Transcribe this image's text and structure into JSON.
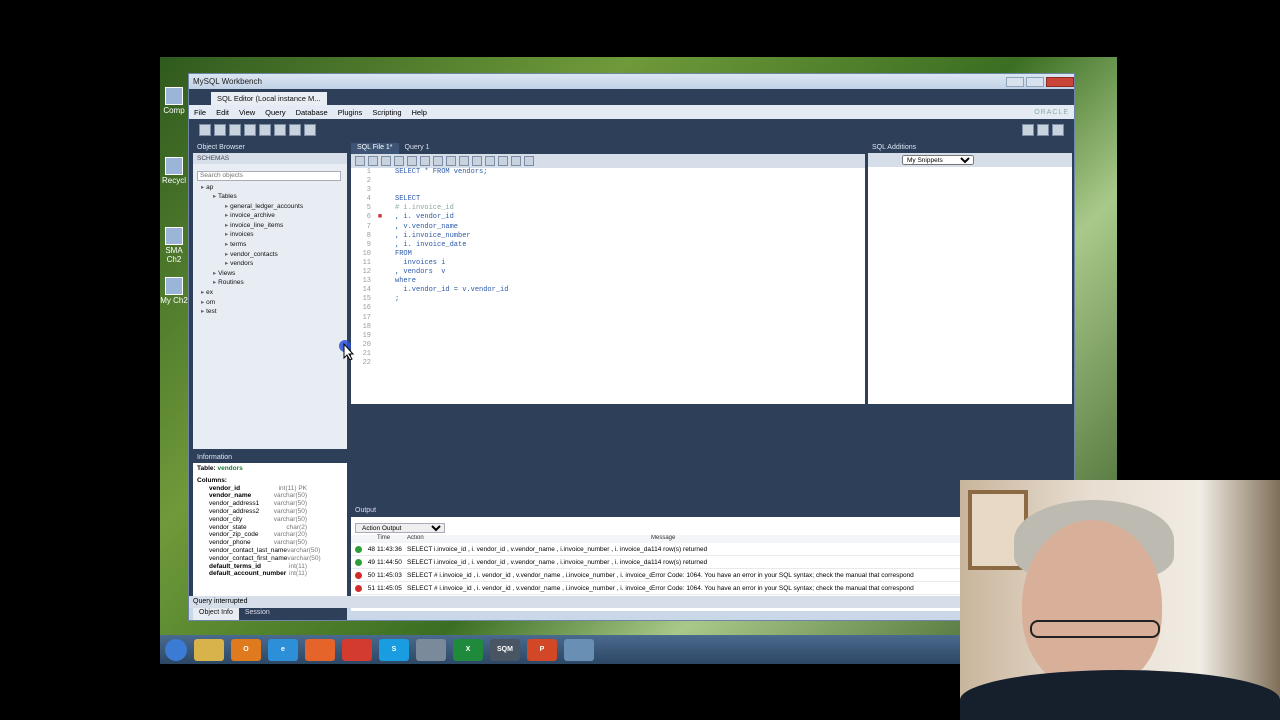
{
  "window": {
    "title": "MySQL Workbench",
    "tab": "SQL Editor (Local instance M...",
    "menu": [
      "File",
      "Edit",
      "View",
      "Query",
      "Database",
      "Plugins",
      "Scripting",
      "Help"
    ],
    "brand": "ORACLE"
  },
  "desktop_icons": [
    "Comp",
    "Recycl",
    "SMA Ch2",
    "My Ch2"
  ],
  "object_browser": {
    "title": "Object Browser",
    "schemas_label": "SCHEMAS",
    "search_placeholder": "Search objects",
    "tree": [
      {
        "label": "ap",
        "level": 0
      },
      {
        "label": "Tables",
        "level": 1
      },
      {
        "label": "general_ledger_accounts",
        "level": 2
      },
      {
        "label": "invoice_archive",
        "level": 2
      },
      {
        "label": "invoice_line_items",
        "level": 2
      },
      {
        "label": "invoices",
        "level": 2
      },
      {
        "label": "terms",
        "level": 2
      },
      {
        "label": "vendor_contacts",
        "level": 2
      },
      {
        "label": "vendors",
        "level": 2
      },
      {
        "label": "Views",
        "level": 1
      },
      {
        "label": "Routines",
        "level": 1
      },
      {
        "label": "ex",
        "level": 0
      },
      {
        "label": "om",
        "level": 0
      },
      {
        "label": "test",
        "level": 0
      }
    ]
  },
  "information": {
    "title": "Information",
    "table_label": "Table:",
    "table_name": "vendors",
    "columns_label": "Columns:",
    "columns": [
      {
        "name": "vendor_id",
        "type": "int(11) PK",
        "bold": true
      },
      {
        "name": "vendor_name",
        "type": "varchar(50)",
        "bold": true
      },
      {
        "name": "vendor_address1",
        "type": "varchar(50)",
        "bold": false
      },
      {
        "name": "vendor_address2",
        "type": "varchar(50)",
        "bold": false
      },
      {
        "name": "vendor_city",
        "type": "varchar(50)",
        "bold": false
      },
      {
        "name": "vendor_state",
        "type": "char(2)",
        "bold": false
      },
      {
        "name": "vendor_zip_code",
        "type": "varchar(20)",
        "bold": false
      },
      {
        "name": "vendor_phone",
        "type": "varchar(50)",
        "bold": false
      },
      {
        "name": "vendor_contact_last_name",
        "type": "varchar(50)",
        "bold": false
      },
      {
        "name": "vendor_contact_first_name",
        "type": "varchar(50)",
        "bold": false
      },
      {
        "name": "default_terms_id",
        "type": "int(11)",
        "bold": true
      },
      {
        "name": "default_account_number",
        "type": "int(11)",
        "bold": true
      }
    ],
    "tabs": [
      "Object Info",
      "Session"
    ]
  },
  "editor": {
    "tabs": [
      "SQL File 1*",
      "Query 1"
    ],
    "lines": [
      {
        "n": "1",
        "text": "SELECT * FROM vendors;",
        "mark": "",
        "comment": false
      },
      {
        "n": "2",
        "text": "",
        "mark": "",
        "comment": false
      },
      {
        "n": "3",
        "text": "",
        "mark": "",
        "comment": false
      },
      {
        "n": "4",
        "text": "SELECT",
        "mark": "",
        "comment": false
      },
      {
        "n": "5",
        "text": "# i.invoice_id",
        "mark": "",
        "comment": true
      },
      {
        "n": "6",
        "text": ", i. vendor_id",
        "mark": "■",
        "comment": false
      },
      {
        "n": "7",
        "text": ", v.vendor_name",
        "mark": "",
        "comment": false
      },
      {
        "n": "8",
        "text": ", i.invoice_number",
        "mark": "",
        "comment": false
      },
      {
        "n": "9",
        "text": ", i. invoice_date",
        "mark": "",
        "comment": false
      },
      {
        "n": "10",
        "text": "FROM",
        "mark": "",
        "comment": false
      },
      {
        "n": "11",
        "text": "  invoices i",
        "mark": "",
        "comment": false
      },
      {
        "n": "12",
        "text": ", vendors  v",
        "mark": "",
        "comment": false
      },
      {
        "n": "13",
        "text": "where",
        "mark": "",
        "comment": false
      },
      {
        "n": "14",
        "text": "  i.vendor_id = v.vendor_id",
        "mark": "",
        "comment": false
      },
      {
        "n": "15",
        "text": ";",
        "mark": "",
        "comment": false
      },
      {
        "n": "16",
        "text": "",
        "mark": "",
        "comment": false
      },
      {
        "n": "17",
        "text": "",
        "mark": "",
        "comment": false
      },
      {
        "n": "18",
        "text": "",
        "mark": "",
        "comment": false
      },
      {
        "n": "19",
        "text": "",
        "mark": "",
        "comment": false
      },
      {
        "n": "20",
        "text": "",
        "mark": "",
        "comment": false
      },
      {
        "n": "21",
        "text": "",
        "mark": "",
        "comment": false
      },
      {
        "n": "22",
        "text": "",
        "mark": "",
        "comment": false
      }
    ]
  },
  "sql_additions": {
    "title": "SQL Additions",
    "snippets": "My Snippets"
  },
  "output": {
    "title": "Output",
    "selector": "Action Output",
    "headers": {
      "time": "Time",
      "action": "Action",
      "message": "Message"
    },
    "rows": [
      {
        "status": "ok",
        "num": "48",
        "time": "11:43:36",
        "action": "SELECT  i.invoice_id , i. vendor_id , v.vendor_name , i.invoice_number , i. invoice_date FROM",
        "message": "114 row(s) returned"
      },
      {
        "status": "ok",
        "num": "49",
        "time": "11:44:50",
        "action": "SELECT  i.invoice_id , i. vendor_id , v.vendor_name , i.invoice_number , i. invoice_date FROM",
        "message": "114 row(s) returned"
      },
      {
        "status": "err",
        "num": "50",
        "time": "11:45:03",
        "action": "SELECT  # i.invoice_id , i. vendor_id , v.vendor_name , i.invoice_number , i. invoice_date FROM",
        "message": "Error Code: 1064. You have an error in your SQL syntax; check the manual that correspond"
      },
      {
        "status": "err",
        "num": "51",
        "time": "11:45:05",
        "action": "SELECT  # i.invoice_id , i. vendor_id , v.vendor_name , i.invoice_number , i. invoice_date FROM",
        "message": "Error Code: 1064. You have an error in your SQL syntax; check the manual that correspond"
      }
    ]
  },
  "status_bar": "Query interrupted",
  "taskbar": [
    {
      "label": "",
      "color": "#3b7bd4",
      "icon": "start-orb-icon"
    },
    {
      "label": "",
      "color": "#d8b24a",
      "icon": "folder-icon"
    },
    {
      "label": "O",
      "color": "#e07a1f",
      "icon": "outlook-icon"
    },
    {
      "label": "e",
      "color": "#2d8fd8",
      "icon": "ie-icon"
    },
    {
      "label": "",
      "color": "#e5642a",
      "icon": "firefox-icon"
    },
    {
      "label": "",
      "color": "#d33b2f",
      "icon": "chrome-icon"
    },
    {
      "label": "S",
      "color": "#1a9ce0",
      "icon": "skype-icon"
    },
    {
      "label": "",
      "color": "#7b8a9b",
      "icon": "workbench-icon"
    },
    {
      "label": "X",
      "color": "#1f8a3c",
      "icon": "excel-icon"
    },
    {
      "label": "SQM",
      "color": "#4a5564",
      "icon": "sqm-icon"
    },
    {
      "label": "P",
      "color": "#d24726",
      "icon": "powerpoint-icon"
    },
    {
      "label": "",
      "color": "#6a8fb5",
      "icon": "app-icon"
    }
  ],
  "colors": {
    "ok": "#2e9e3a",
    "err": "#d22b2b",
    "keyword": "#2d5aa8"
  }
}
